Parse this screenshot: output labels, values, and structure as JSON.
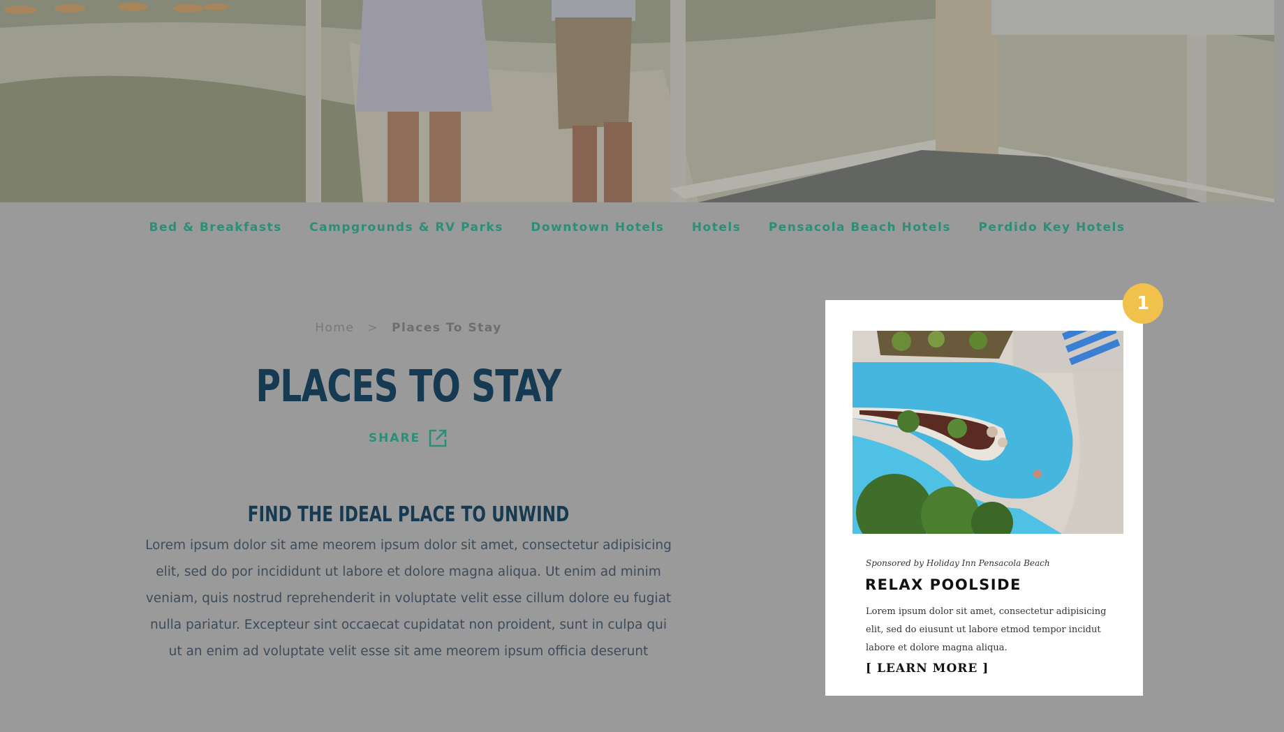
{
  "nav": {
    "items": [
      {
        "label": "Bed & Breakfasts"
      },
      {
        "label": "Campgrounds & RV Parks"
      },
      {
        "label": "Downtown Hotels"
      },
      {
        "label": "Hotels"
      },
      {
        "label": "Pensacola Beach Hotels"
      },
      {
        "label": "Perdido Key Hotels"
      }
    ]
  },
  "breadcrumb": {
    "home": "Home",
    "separator": ">",
    "current": "Places To Stay"
  },
  "page": {
    "title": "PLACES TO STAY",
    "share_label": "SHARE",
    "subheading": "FIND THE IDEAL PLACE TO UNWIND",
    "body_lines": [
      "Lorem ipsum dolor sit ame meorem ipsum dolor sit amet, consectetur adipisicing",
      "elit, sed do por incididunt ut labore et dolore magna aliqua. Ut enim ad minim",
      "veniam, quis nostrud  reprehenderit in voluptate velit esse cillum dolore eu fugiat",
      "nulla pariatur. Excepteur sint occaecat cupidatat non proident, sunt in culpa qui",
      "ut an enim ad voluptate velit esse sit ame meorem ipsum officia deserunt"
    ]
  },
  "ad": {
    "sponsor": "Sponsored by Holiday Inn Pensacola Beach",
    "title": "RELAX POOLSIDE",
    "body_lines": [
      "Lorem ipsum dolor sit amet, consectetur adipisicing",
      "elit, sed do eiusunt ut labore etmod tempor incidut",
      "labore et dolore magna aliqua."
    ],
    "cta": "[ LEARN MORE ]"
  },
  "badge": "1",
  "colors": {
    "accent_teal": "#2b8f78",
    "title_navy": "#163a52",
    "overlay_gray": "#9a9a9a",
    "badge_yellow": "#f2c14b"
  }
}
